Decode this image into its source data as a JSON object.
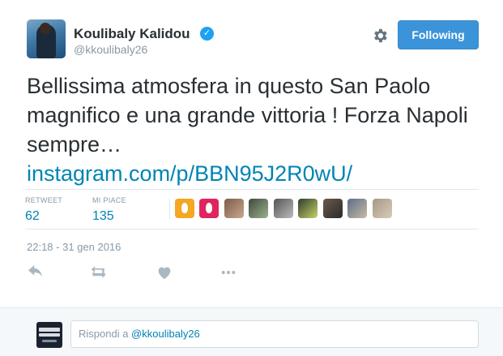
{
  "author": {
    "name": "Koulibaly Kalidou",
    "handle": "@kkoulibaly26",
    "verified": true
  },
  "follow_button": {
    "label": "Following"
  },
  "icons": {
    "settings": "gear-icon",
    "verified": "verified-badge-icon",
    "reply": "reply-icon",
    "retweet": "retweet-icon",
    "like": "heart-icon",
    "more": "more-icon"
  },
  "tweet": {
    "text": "Bellissima atmosfera in questo San Paolo magnifico e una grande vittoria ! Forza Napoli sempre…",
    "link": "instagram.com/p/BBN95J2R0wU/",
    "date": "22:18 - 31 gen 2016"
  },
  "stats": {
    "retweets_label": "RETWEET",
    "retweets": "62",
    "likes_label": "MI PIACE",
    "likes": "135"
  },
  "likers_count_shown": 9,
  "reply": {
    "prefix": "Rispondi a ",
    "mention": "@kkoulibaly26"
  },
  "colors": {
    "accent": "#0084b4",
    "button": "#3b94d9",
    "muted": "#8899a6",
    "reply_bar": "#f5f8fa"
  }
}
